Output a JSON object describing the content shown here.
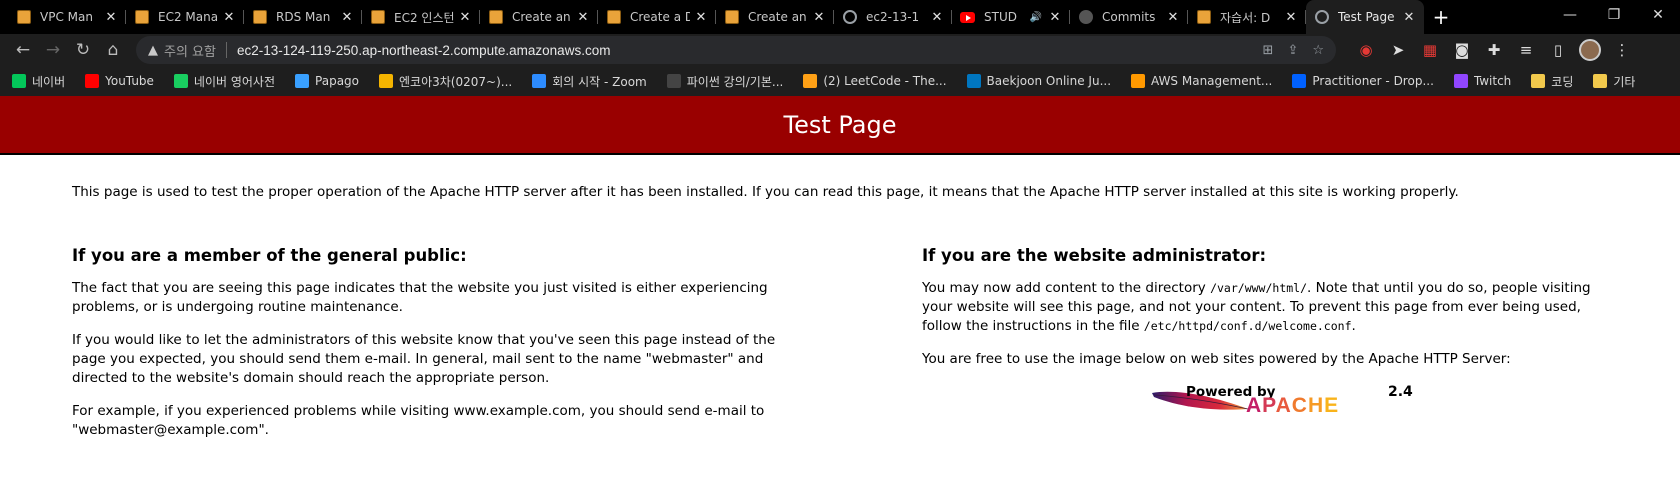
{
  "browser": {
    "tabs": [
      {
        "title": "VPC Man",
        "icon": "aws-cube-icon",
        "active": false
      },
      {
        "title": "EC2 Mana",
        "icon": "aws-cube-icon",
        "active": false
      },
      {
        "title": "RDS Man",
        "icon": "aws-cube-icon",
        "active": false
      },
      {
        "title": "EC2 인스턴",
        "icon": "aws-cube-icon",
        "active": false
      },
      {
        "title": "Create an",
        "icon": "aws-cube-icon",
        "active": false
      },
      {
        "title": "Create a D",
        "icon": "aws-cube-icon",
        "active": false
      },
      {
        "title": "Create an",
        "icon": "aws-cube-icon",
        "active": false
      },
      {
        "title": "ec2-13-1",
        "icon": "globe-icon",
        "active": false
      },
      {
        "title": "STUD",
        "icon": "youtube-icon",
        "active": false,
        "audio": true
      },
      {
        "title": "Commits",
        "icon": "github-icon",
        "active": false
      },
      {
        "title": "자습서: D",
        "icon": "aws-cube-icon",
        "active": false
      },
      {
        "title": "Test Page",
        "icon": "globe-icon",
        "active": true
      }
    ],
    "new_tab_symbol": "+",
    "window_controls": {
      "minimize": "—",
      "restore": "❐",
      "close": "✕"
    },
    "security_label": "주의 요함",
    "url": "ec2-13-124-119-250.ap-northeast-2.compute.amazonaws.com",
    "bookmarks": [
      {
        "label": "네이버",
        "color": "#03c75a"
      },
      {
        "label": "YouTube",
        "color": "#ff0000"
      },
      {
        "label": "네이버 영어사전",
        "color": "#19ce60"
      },
      {
        "label": "Papago",
        "color": "#39a0ff"
      },
      {
        "label": "엔코아3차(0207~)...",
        "color": "#f4b400"
      },
      {
        "label": "회의 시작 - Zoom",
        "color": "#2d8cff"
      },
      {
        "label": "파이썬 강의/기본...",
        "color": "#444444"
      },
      {
        "label": "(2) LeetCode - The...",
        "color": "#ffa116"
      },
      {
        "label": "Baekjoon Online Ju...",
        "color": "#0076c0"
      },
      {
        "label": "AWS Management...",
        "color": "#ff9900"
      },
      {
        "label": "Practitioner - Drop...",
        "color": "#0061ff"
      },
      {
        "label": "Twitch",
        "color": "#9146ff"
      },
      {
        "label": "코딩",
        "color": "#f2c94c"
      },
      {
        "label": "기타",
        "color": "#f2c94c"
      }
    ]
  },
  "page": {
    "title": "Test Page",
    "intro": "This page is used to test the proper operation of the Apache HTTP server after it has been installed. If you can read this page, it means that the Apache HTTP server installed at this site is working properly.",
    "public": {
      "heading": "If you are a member of the general public:",
      "p1": "The fact that you are seeing this page indicates that the website you just visited is either experiencing problems, or is undergoing routine maintenance.",
      "p2": "If you would like to let the administrators of this website know that you've seen this page instead of the page you expected, you should send them e-mail. In general, mail sent to the name \"webmaster\" and directed to the website's domain should reach the appropriate person.",
      "p3": "For example, if you experienced problems while visiting www.example.com, you should send e-mail to \"webmaster@example.com\"."
    },
    "admin": {
      "heading": "If you are the website administrator:",
      "p1_a": "You may now add content to the directory ",
      "p1_dir": "/var/www/html/",
      "p1_b": ". Note that until you do so, people visiting your website will see this page, and not your content. To prevent this page from ever being used, follow the instructions in the file ",
      "p1_file": "/etc/httpd/conf.d/welcome.conf",
      "p1_c": ".",
      "p2": "You are free to use the image below on web sites powered by the Apache HTTP Server:",
      "badge_powered": "Powered by",
      "badge_version": "2.4",
      "badge_name": "APACHE"
    }
  }
}
